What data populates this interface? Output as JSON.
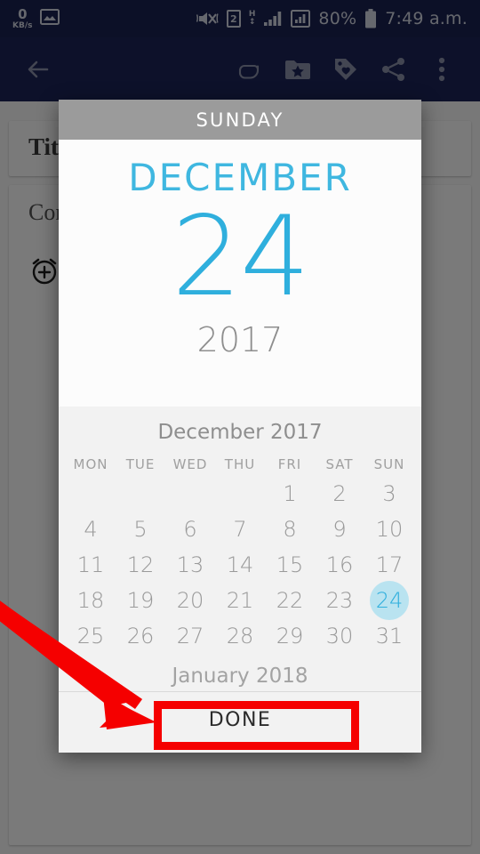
{
  "status_bar": {
    "network_speed_value": "0",
    "network_speed_unit": "KB/s",
    "image_icon": "image-icon",
    "mute_icon": "volume-mute-icon",
    "sim_badge": "2",
    "hspa_letter": "H",
    "hspa_arrows": "↕",
    "signal_icon_1": "signal-bars-icon",
    "signal_icon_2": "signal-bars-boxed-icon",
    "battery_percent": "80%",
    "battery_icon": "battery-icon",
    "time": "7:49 a.m."
  },
  "app_bar": {
    "back_icon": "back-arrow-icon",
    "actions": [
      {
        "name": "attach-icon",
        "label": "Attach"
      },
      {
        "name": "folder-star-icon",
        "label": "Notebook"
      },
      {
        "name": "tag-heart-icon",
        "label": "Tag"
      },
      {
        "name": "share-icon",
        "label": "Share"
      },
      {
        "name": "overflow-menu-icon",
        "label": "More options"
      }
    ]
  },
  "form": {
    "title_field_label": "Title",
    "content_field_label": "Content",
    "reminder_icon": "alarm-add-icon"
  },
  "dialog": {
    "weekday": "SUNDAY",
    "hero_month": "DECEMBER",
    "hero_day": "24",
    "hero_year": "2017",
    "done_label": "DONE",
    "accent_color": "#2fafdd",
    "header_color": "#9b9b9b",
    "selected_pill_color": "#b9e3f0"
  },
  "calendar": {
    "month_label": "December 2017",
    "next_month_label": "January 2018",
    "day_names": [
      "MON",
      "TUE",
      "WED",
      "THU",
      "FRI",
      "SAT",
      "SUN"
    ],
    "selected_day": 24,
    "leading_blanks": 4,
    "days": [
      1,
      2,
      3,
      4,
      5,
      6,
      7,
      8,
      9,
      10,
      11,
      12,
      13,
      14,
      15,
      16,
      17,
      18,
      19,
      20,
      21,
      22,
      23,
      24,
      25,
      26,
      27,
      28,
      29,
      30,
      31
    ]
  },
  "annotation": {
    "arrow_color": "#f50000",
    "highlight_color": "#f50000",
    "highlight_target": "done-button"
  }
}
